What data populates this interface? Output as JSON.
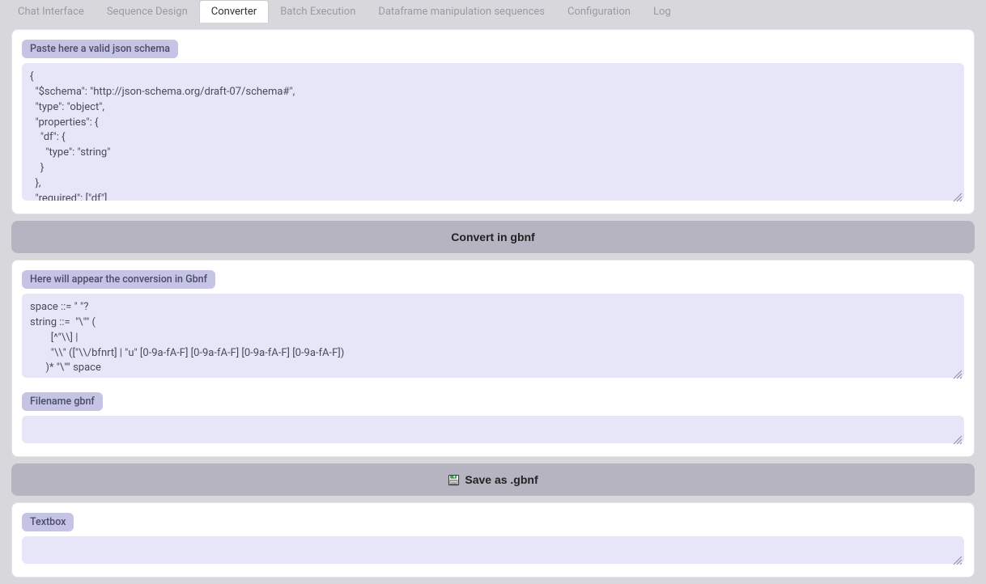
{
  "tabs": {
    "items": [
      {
        "label": "Chat Interface",
        "active": false
      },
      {
        "label": "Sequence Design",
        "active": false
      },
      {
        "label": "Converter",
        "active": true
      },
      {
        "label": "Batch Execution",
        "active": false
      },
      {
        "label": "Dataframe manipulation sequences",
        "active": false
      },
      {
        "label": "Configuration",
        "active": false
      },
      {
        "label": "Log",
        "active": false
      }
    ]
  },
  "schema_panel": {
    "label": "Paste here a valid json schema",
    "value": "{\n  \"$schema\": \"http://json-schema.org/draft-07/schema#\",\n  \"type\": \"object\",\n  \"properties\": {\n    \"df\": {\n      \"type\": \"string\"\n    }\n  },\n  \"required\": [\"df\"]\n}"
  },
  "convert_button": {
    "label": "Convert in gbnf"
  },
  "output_panel": {
    "label": "Here will appear the conversion in Gbnf",
    "value": "space ::= \" \"?\nstring ::=  \"\\\"\" (\n        [^\"\\\\] |\n        \"\\\\\" ([\"\\\\/bfnrt] | \"u\" [0-9a-fA-F] [0-9a-fA-F] [0-9a-fA-F] [0-9a-fA-F])\n      )* \"\\\"\" space\nroot ::= \"{\" space \"\\\"df\\\"\" space \":\" space string \"}\" space"
  },
  "filename_panel": {
    "label": "Filename gbnf",
    "value": ""
  },
  "save_button": {
    "label": "Save as .gbnf"
  },
  "textbox_panel": {
    "label": "Textbox",
    "value": ""
  }
}
